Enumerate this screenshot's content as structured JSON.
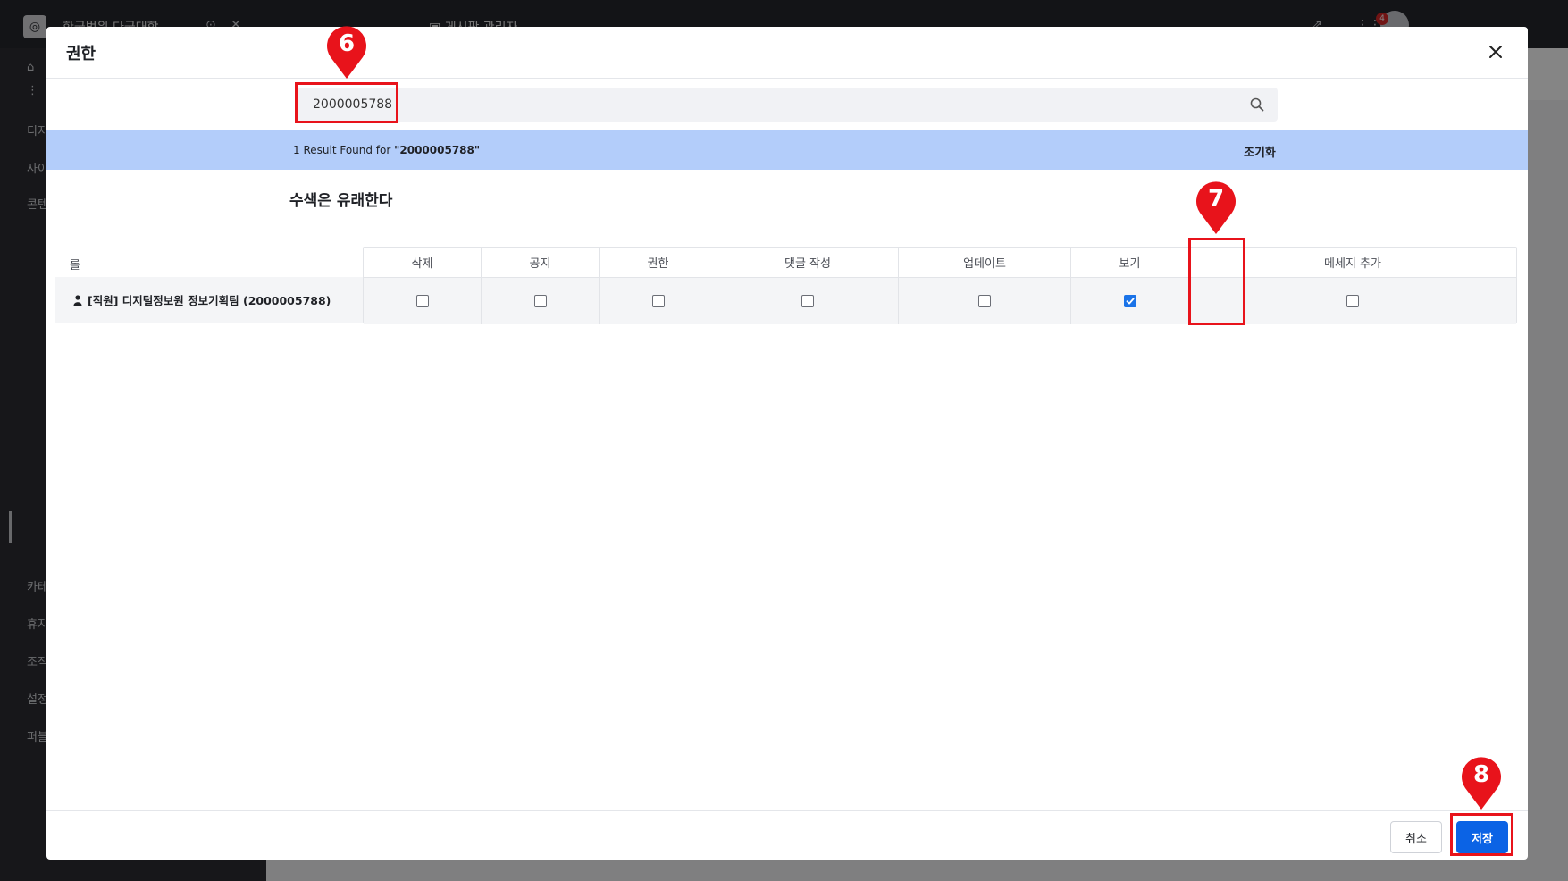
{
  "background": {
    "site_name": "한국범위 다국대학",
    "page_title": "게시판 관리자",
    "notification_count": "4",
    "sidebar_items": [
      "디지",
      "사이",
      "콘텐",
      "카테",
      "휴지",
      "조직",
      "설정",
      "퍼블"
    ]
  },
  "modal": {
    "title": "권한",
    "search": {
      "value": "2000005788",
      "placeholder": ""
    },
    "result": {
      "prefix": "1 Result Found for ",
      "query": "\"2000005788\"",
      "reset_label": "조기화"
    },
    "section_title": "수색은 유래한다",
    "table": {
      "role_header": "롤",
      "columns": [
        "삭제",
        "공지",
        "권한",
        "댓글 작성",
        "업데이트",
        "보기",
        "메세지 추가"
      ],
      "rows": [
        {
          "role": "[직원] 디지털정보원 정보기획팀 (2000005788)",
          "checked": [
            false,
            false,
            false,
            false,
            false,
            true,
            false
          ]
        }
      ]
    },
    "footer": {
      "cancel_label": "취소",
      "save_label": "저장"
    }
  },
  "annotations": {
    "step_search": "6",
    "step_view_checkbox": "7",
    "step_save": "8",
    "highlight_color": "#e8131b"
  },
  "colors": {
    "result_bar": "#b3cdfa",
    "primary": "#0b63e5",
    "checkbox_checked": "#1a73e8"
  }
}
